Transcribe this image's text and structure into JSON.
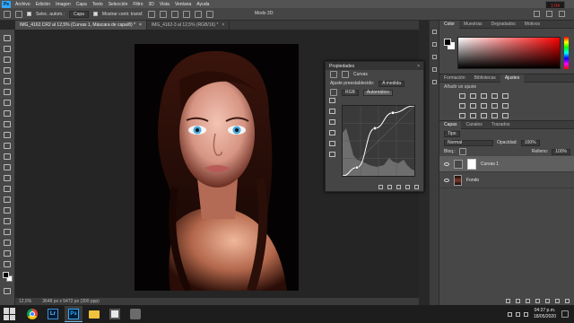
{
  "menubar": {
    "app_logo": "Ps",
    "items": [
      "Archivo",
      "Edición",
      "Imagen",
      "Capa",
      "Texto",
      "Selección",
      "Filtro",
      "3D",
      "Vista",
      "Ventana",
      "Ayuda"
    ],
    "rec_badge": "1:04"
  },
  "options": {
    "auto_select": "Selec. autom.:",
    "auto_select_target": "Capa",
    "show_transform": "Mostrar contr. transf.",
    "mode_3d": "Modo 3D:"
  },
  "tabs": [
    {
      "label": "IMG_4162.CR2 al 12,5% (Curvas 1, Máscara de capa/8) *",
      "close": "×"
    },
    {
      "label": "IMG_4162-3 al 12,5% (RGB/16) *",
      "close": "×"
    }
  ],
  "status": {
    "zoom": "12,5%",
    "doc_size": "3648 px x 5472 px (300 ppp)"
  },
  "properties": {
    "header": "Propiedades",
    "close": "×",
    "title": "Curvas",
    "preset_label": "Ajuste preestablecido:",
    "preset_value": "A medida",
    "channel": "RGB",
    "auto_button": "Automático",
    "curve_points": [
      [
        0,
        0
      ],
      [
        0.2,
        0.12
      ],
      [
        0.45,
        0.68
      ],
      [
        0.7,
        0.9
      ],
      [
        1,
        1
      ]
    ],
    "curve_color": "#ffffff"
  },
  "color_panel": {
    "tabs": [
      "Color",
      "Muestras",
      "Degradados",
      "Motivos"
    ],
    "foreground": "#000000",
    "background": "#ffffff",
    "hue": "#ff0000"
  },
  "adjustments_panel": {
    "tabs": [
      "Formación",
      "Bibliotecas",
      "Ajustes"
    ],
    "add_label": "Añadir un ajuste"
  },
  "layers_panel": {
    "tabs": [
      "Capas",
      "Canales",
      "Trazados"
    ],
    "filter": "Tipo",
    "blend_mode": "Normal",
    "opacity_label": "Opacidad:",
    "opacity_value": "100%",
    "lock_label": "Bloq.:",
    "fill_label": "Relleno:",
    "fill_value": "100%",
    "layers": [
      {
        "name": "Curvas 1",
        "type": "adjustment",
        "selected": true
      },
      {
        "name": "Fondo",
        "type": "image",
        "selected": false
      }
    ]
  },
  "taskbar": {
    "apps": [
      "chrome",
      "lightroom",
      "photoshop",
      "explorer",
      "media",
      "app"
    ],
    "lr_label": "Lr",
    "ps_label": "Ps",
    "time": "04:27 p.m.",
    "date": "18/05/2020"
  }
}
